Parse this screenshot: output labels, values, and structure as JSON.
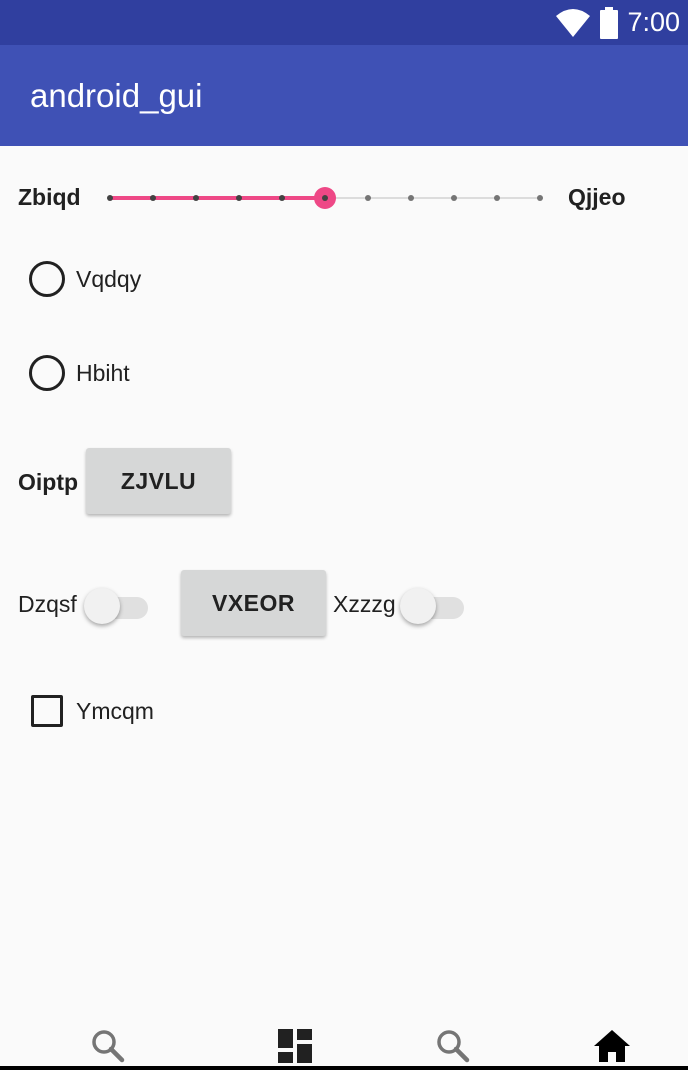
{
  "status_bar": {
    "time": "7:00",
    "icons": [
      "wifi-icon",
      "battery-icon"
    ]
  },
  "app_bar": {
    "title": "android_gui"
  },
  "seekbar": {
    "left_label": "Zbiqd",
    "right_label": "Qjjeo",
    "max": 10,
    "value": 5
  },
  "radios": [
    {
      "label": "Vqdqy",
      "checked": false
    },
    {
      "label": "Hbiht",
      "checked": false
    }
  ],
  "button_row": {
    "label": "Oiptp",
    "button": "ZJVLU"
  },
  "switch_row": {
    "switch1_label": "Dzqsf",
    "switch1_on": false,
    "button": "VXEOR",
    "switch2_label": "Xzzzg",
    "switch2_on": false
  },
  "checkbox": {
    "label": "Ymcqm",
    "checked": false
  },
  "bottom_nav": [
    "search-icon",
    "dashboard-icon",
    "search-icon",
    "home-icon"
  ],
  "colors": {
    "status_bar": "#303f9f",
    "app_bar": "#3f51b5",
    "accent": "#ee4886",
    "button": "#d6d7d7"
  }
}
